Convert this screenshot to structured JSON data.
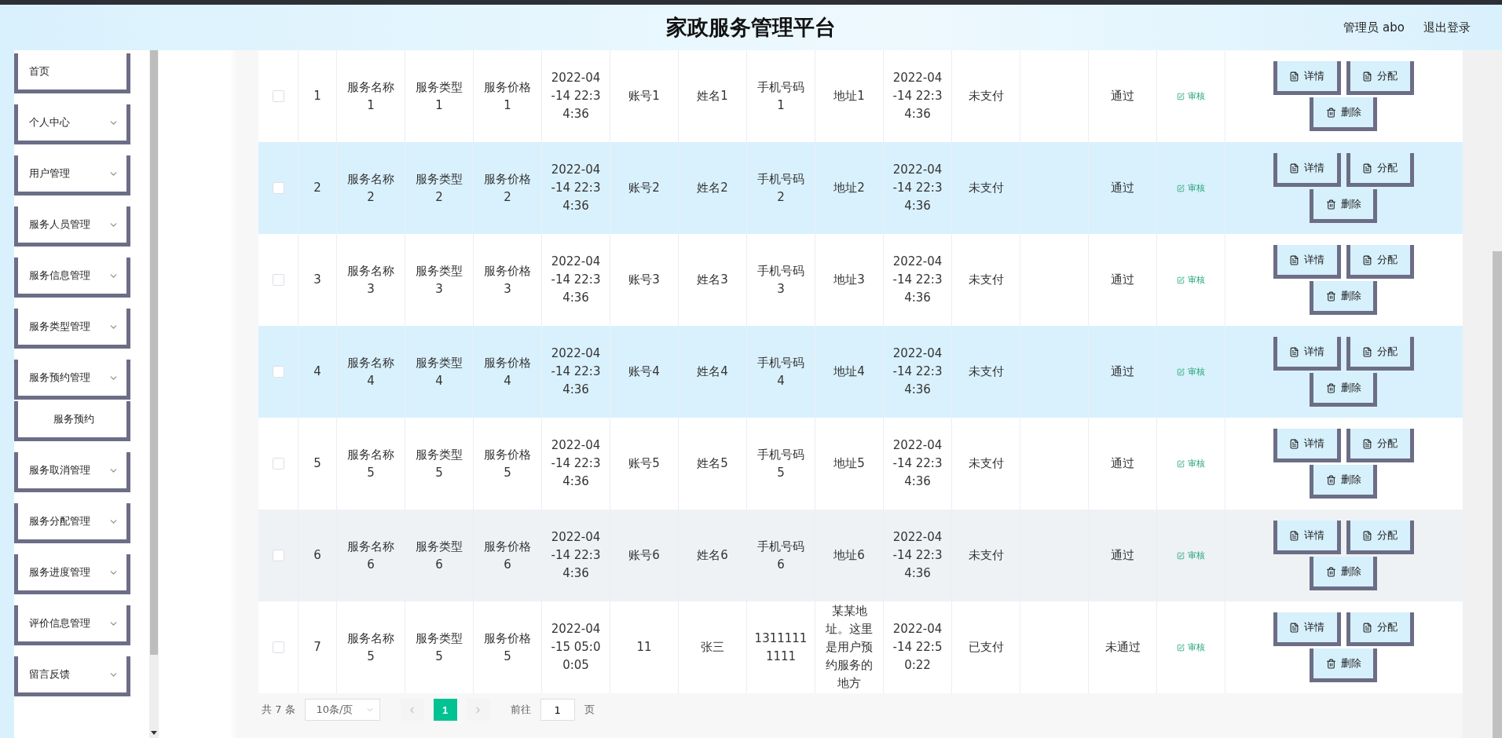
{
  "header": {
    "title": "家政服务管理平台",
    "user": "管理员 abo",
    "logout": "退出登录"
  },
  "sidebar": {
    "items": [
      {
        "label": "首页",
        "kind": "link"
      },
      {
        "label": "个人中心",
        "kind": "menu"
      },
      {
        "label": "用户管理",
        "kind": "menu"
      },
      {
        "label": "服务人员管理",
        "kind": "menu"
      },
      {
        "label": "服务信息管理",
        "kind": "menu"
      },
      {
        "label": "服务类型管理",
        "kind": "menu"
      },
      {
        "label": "服务预约管理",
        "kind": "menu",
        "children": [
          {
            "label": "服务预约"
          }
        ]
      },
      {
        "label": "服务取消管理",
        "kind": "menu"
      },
      {
        "label": "服务分配管理",
        "kind": "menu"
      },
      {
        "label": "服务进度管理",
        "kind": "menu"
      },
      {
        "label": "评价信息管理",
        "kind": "menu"
      },
      {
        "label": "留言反馈",
        "kind": "menu"
      }
    ]
  },
  "table": {
    "rows": [
      {
        "kind": "plain",
        "checked": false,
        "cells": [
          "1",
          "服务名称1",
          "服务类型1",
          "服务价格1",
          "2022-04-14 22:34:36",
          "账号1",
          "姓名1",
          "手机号码1",
          "地址1",
          "2022-04-14 22:34:36",
          "未支付"
        ],
        "status": "通过",
        "review": "审核",
        "actions": [
          "详情",
          "分配",
          "删除"
        ]
      },
      {
        "kind": "striped",
        "checked": false,
        "cells": [
          "2",
          "服务名称2",
          "服务类型2",
          "服务价格2",
          "2022-04-14 22:34:36",
          "账号2",
          "姓名2",
          "手机号码2",
          "地址2",
          "2022-04-14 22:34:36",
          "未支付"
        ],
        "status": "通过",
        "review": "审核",
        "actions": [
          "详情",
          "分配",
          "删除"
        ]
      },
      {
        "kind": "plain",
        "checked": false,
        "cells": [
          "3",
          "服务名称3",
          "服务类型3",
          "服务价格3",
          "2022-04-14 22:34:36",
          "账号3",
          "姓名3",
          "手机号码3",
          "地址3",
          "2022-04-14 22:34:36",
          "未支付"
        ],
        "status": "通过",
        "review": "审核",
        "actions": [
          "详情",
          "分配",
          "删除"
        ]
      },
      {
        "kind": "striped",
        "checked": false,
        "cells": [
          "4",
          "服务名称4",
          "服务类型4",
          "服务价格4",
          "2022-04-14 22:34:36",
          "账号4",
          "姓名4",
          "手机号码4",
          "地址4",
          "2022-04-14 22:34:36",
          "未支付"
        ],
        "status": "通过",
        "review": "审核",
        "actions": [
          "详情",
          "分配",
          "删除"
        ]
      },
      {
        "kind": "plain",
        "checked": false,
        "cells": [
          "5",
          "服务名称5",
          "服务类型5",
          "服务价格5",
          "2022-04-14 22:34:36",
          "账号5",
          "姓名5",
          "手机号码5",
          "地址5",
          "2022-04-14 22:34:36",
          "未支付"
        ],
        "status": "通过",
        "review": "审核",
        "actions": [
          "详情",
          "分配",
          "删除"
        ]
      },
      {
        "kind": "hovered",
        "checked": false,
        "cells": [
          "6",
          "服务名称6",
          "服务类型6",
          "服务价格6",
          "2022-04-14 22:34:36",
          "账号6",
          "姓名6",
          "手机号码6",
          "地址6",
          "2022-04-14 22:34:36",
          "未支付"
        ],
        "status": "通过",
        "review": "审核",
        "actions": [
          "详情",
          "分配",
          "删除"
        ]
      },
      {
        "kind": "plain",
        "checked": false,
        "cells": [
          "7",
          "服务名称5",
          "服务类型5",
          "服务价格5",
          "2022-04-15 05:00:05",
          "11",
          "张三",
          "13111111111",
          "某某地址。这里是用户预约服务的地方",
          "2022-04-14 22:50:22",
          "已支付"
        ],
        "status": "未通过",
        "review": "审核",
        "actions": [
          "详情",
          "分配",
          "删除"
        ]
      }
    ]
  },
  "pagination": {
    "total": "共 7 条",
    "page_size": "10条/页",
    "pages": [
      {
        "label": "1",
        "selected": true
      }
    ],
    "goto_label": "前往",
    "goto_value": "1",
    "goto_unit": "页"
  }
}
